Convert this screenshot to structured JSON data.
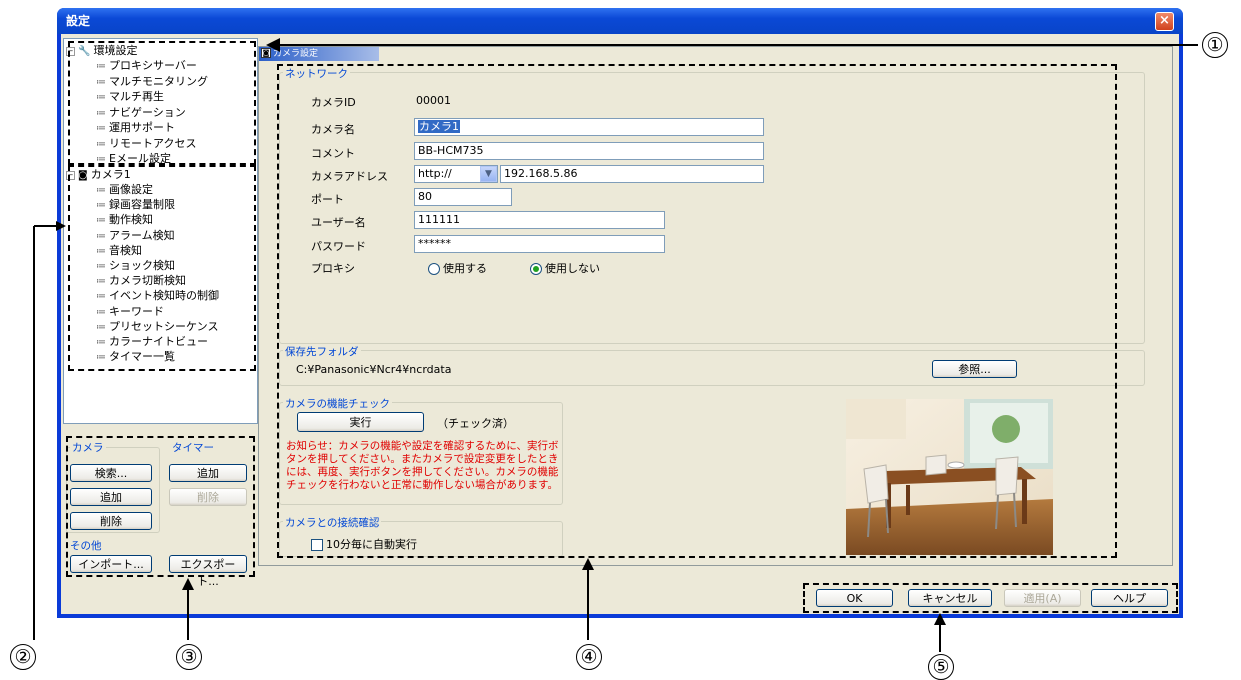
{
  "window": {
    "title": "設定",
    "close_label": "×"
  },
  "tree": {
    "env": {
      "label": "環境設定",
      "items": [
        "プロキシサーバー",
        "マルチモニタリング",
        "マルチ再生",
        "ナビゲーション",
        "運用サポート",
        "リモートアクセス",
        "Eメール設定"
      ]
    },
    "camera": {
      "label": "カメラ1",
      "items": [
        "画像設定",
        "録画容量制限",
        "動作検知",
        "アラーム検知",
        "音検知",
        "ショック検知",
        "カメラ切断検知",
        "イベント検知時の制御",
        "キーワード",
        "プリセットシーケンス",
        "カラーナイトビュー",
        "タイマー一覧"
      ]
    }
  },
  "left_buttons": {
    "camera_group": "カメラ",
    "timer_group": "タイマー",
    "other_group": "その他",
    "search": "検索...",
    "add_camera": "追加",
    "delete_camera": "削除",
    "add_timer": "追加",
    "delete_timer": "削除",
    "import": "インポート...",
    "export": "エクスポート..."
  },
  "panel": {
    "header": "カメラ設定",
    "network_group": "ネットワーク",
    "camera_id_label": "カメラID",
    "camera_id_value": "00001",
    "camera_name_label": "カメラ名",
    "camera_name_value": "カメラ1",
    "comment_label": "コメント",
    "comment_value": "BB-HCM735",
    "address_label": "カメラアドレス",
    "protocol_value": "http://",
    "address_value": "192.168.5.86",
    "port_label": "ポート",
    "port_value": "80",
    "username_label": "ユーザー名",
    "username_value": "111111",
    "password_label": "パスワード",
    "password_value": "******",
    "proxy_label": "プロキシ",
    "proxy_use": "使用する",
    "proxy_nouse": "使用しない",
    "proxy_selected": "使用しない",
    "folder_group": "保存先フォルダ",
    "folder_value": "C:¥Panasonic¥Ncr4¥ncrdata",
    "browse_button": "参照...",
    "check_group": "カメラの機能チェック",
    "run_button": "実行",
    "check_status": "（チェック済）",
    "notice": "お知らせ：カメラの機能や設定を確認するために、実行ボタンを押してください。またカメラで設定変更をしたときには、再度、実行ボタンを押してください。カメラの機能チェックを行わないと正常に動作しない場合があります。",
    "connection_group": "カメラとの接続確認",
    "auto_check_label": "10分毎に自動実行",
    "auto_check_checked": false
  },
  "bottom_buttons": {
    "ok": "OK",
    "cancel": "キャンセル",
    "apply": "適用(A)",
    "help": "ヘルプ"
  },
  "callouts": {
    "c1": "①",
    "c2": "②",
    "c3": "③",
    "c4": "④",
    "c5": "⑤"
  }
}
